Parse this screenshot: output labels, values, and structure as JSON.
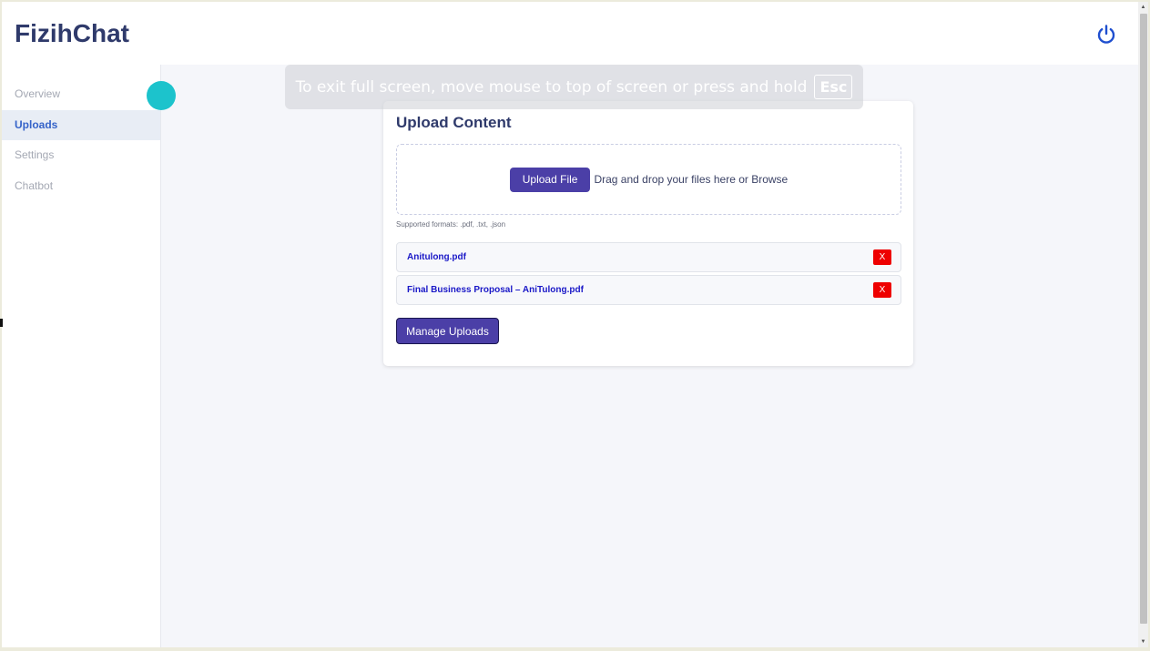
{
  "app": {
    "title": "FizihChat"
  },
  "header": {
    "power_icon": "power-icon"
  },
  "sidebar": {
    "items": [
      {
        "label": "Overview",
        "active": false
      },
      {
        "label": "Uploads",
        "active": true
      },
      {
        "label": "Settings",
        "active": false
      },
      {
        "label": "Chatbot",
        "active": false
      }
    ]
  },
  "fullscreen_notice": {
    "text": "To exit full screen, move mouse to top of screen or press and hold",
    "key": "Esc"
  },
  "upload_card": {
    "title": "Upload Content",
    "upload_button": "Upload File",
    "drop_text": "Drag and drop your files here or Browse",
    "supported_formats": "Supported formats: .pdf, .txt, .json",
    "files": [
      {
        "name": "Anitulong.pdf",
        "remove_label": "X"
      },
      {
        "name": "Final Business Proposal – AniTulong.pdf",
        "remove_label": "X"
      }
    ],
    "manage_button": "Manage Uploads"
  },
  "colors": {
    "brand": "#2f3a6b",
    "accent": "#4b3fa7",
    "active_nav": "#3563c9",
    "danger": "#ee0000",
    "file_link": "#1a18c7",
    "cursor_highlight": "#1cc3cc"
  }
}
